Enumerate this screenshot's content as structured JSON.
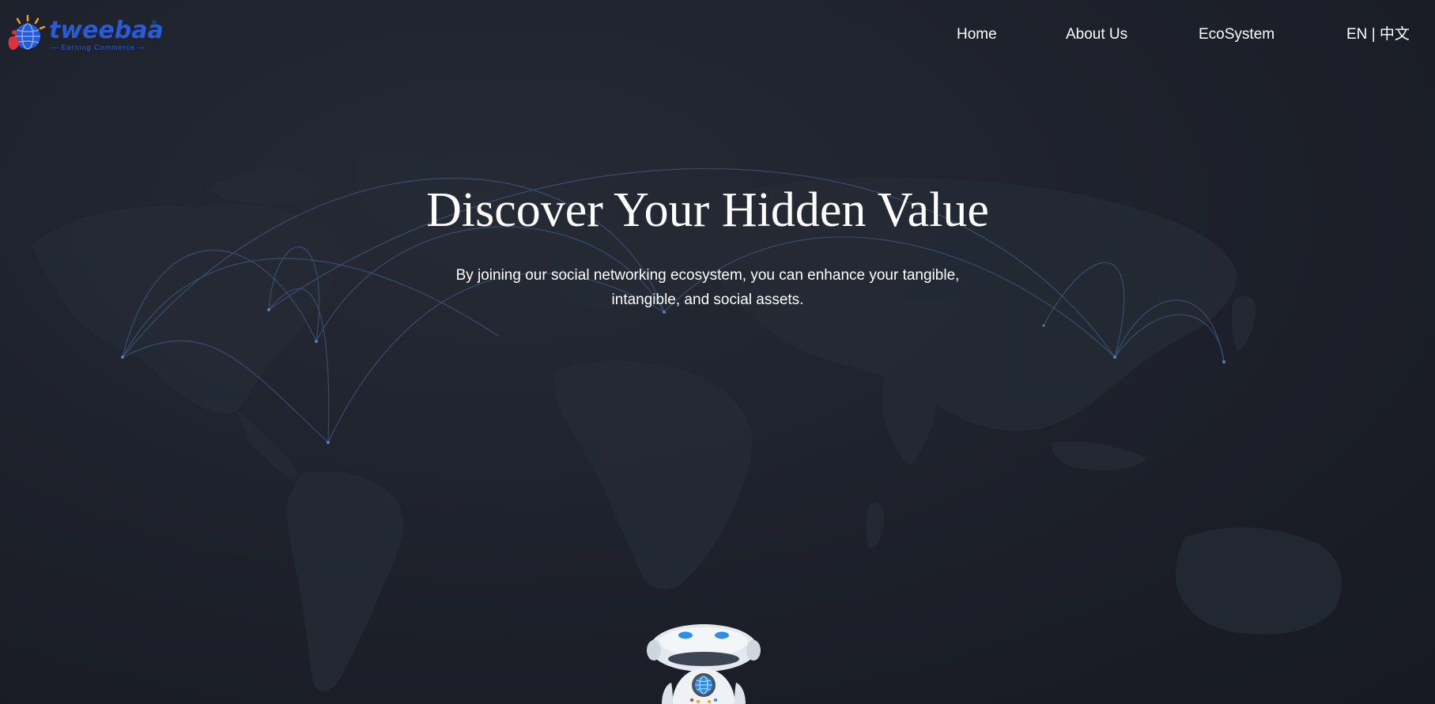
{
  "brand": {
    "name": "tweebaa",
    "registered_mark": "®",
    "tagline": "— Earning Commerce —",
    "logo_icon": "globe-logo-icon"
  },
  "nav": {
    "home": "Home",
    "about": "About Us",
    "ecosystem": "EcoSystem"
  },
  "language": {
    "en": "EN",
    "separator": "|",
    "zh": "中文"
  },
  "hero": {
    "title": "Discover Your Hidden Value",
    "subtitle_line1": "By joining our social networking ecosystem, you can enhance your tangible,",
    "subtitle_line2": "intangible, and social assets."
  },
  "colors": {
    "background": "#1a1d26",
    "map_land": "#252a35",
    "arc_line": "#3d5a80",
    "brand_blue": "#2a5bd7",
    "text": "#ffffff"
  },
  "icons": {
    "robot": "robot-mascot-icon"
  }
}
